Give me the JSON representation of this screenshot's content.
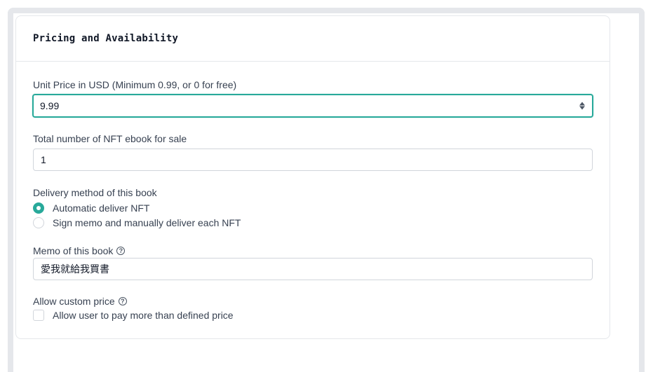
{
  "section": {
    "title": "Pricing and Availability"
  },
  "price": {
    "label": "Unit Price in USD (Minimum 0.99, or 0 for free)",
    "value": "9.99"
  },
  "quantity": {
    "label": "Total number of NFT ebook for sale",
    "value": "1"
  },
  "delivery": {
    "label": "Delivery method of this book",
    "options": [
      {
        "label": "Automatic deliver NFT",
        "selected": true
      },
      {
        "label": "Sign memo and manually deliver each NFT",
        "selected": false
      }
    ]
  },
  "memo": {
    "label": "Memo of this book",
    "value": "愛我就給我買書",
    "help_icon": "question-circle-icon"
  },
  "custom_price": {
    "label": "Allow custom price",
    "help_icon": "question-circle-icon",
    "checkbox_label": "Allow user to pay more than defined price",
    "checked": false
  },
  "colors": {
    "accent": "#28a99a",
    "border": "#d1d5db"
  }
}
